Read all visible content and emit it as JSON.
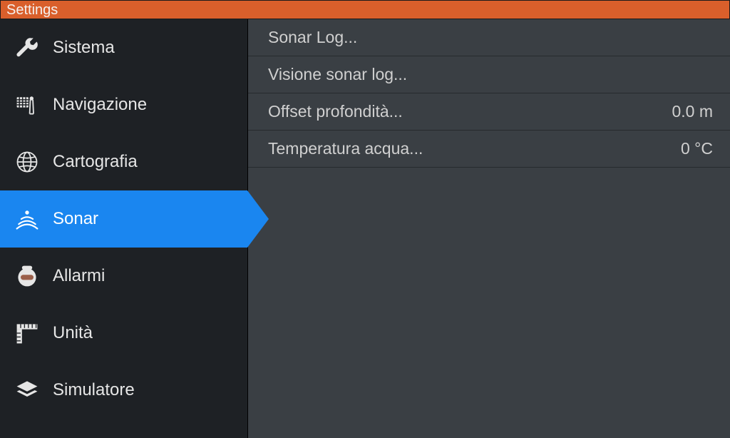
{
  "titlebar": {
    "title": "Settings"
  },
  "sidebar": {
    "items": [
      {
        "label": "Sistema"
      },
      {
        "label": "Navigazione"
      },
      {
        "label": "Cartografia"
      },
      {
        "label": "Sonar"
      },
      {
        "label": "Allarmi"
      },
      {
        "label": "Unità"
      },
      {
        "label": "Simulatore"
      }
    ],
    "activeIndex": 3
  },
  "content": {
    "rows": [
      {
        "label": "Sonar Log...",
        "value": ""
      },
      {
        "label": "Visione sonar log...",
        "value": ""
      },
      {
        "label": "Offset profondità...",
        "value": "0.0 m"
      },
      {
        "label": "Temperatura acqua...",
        "value": "0 °C"
      }
    ]
  }
}
